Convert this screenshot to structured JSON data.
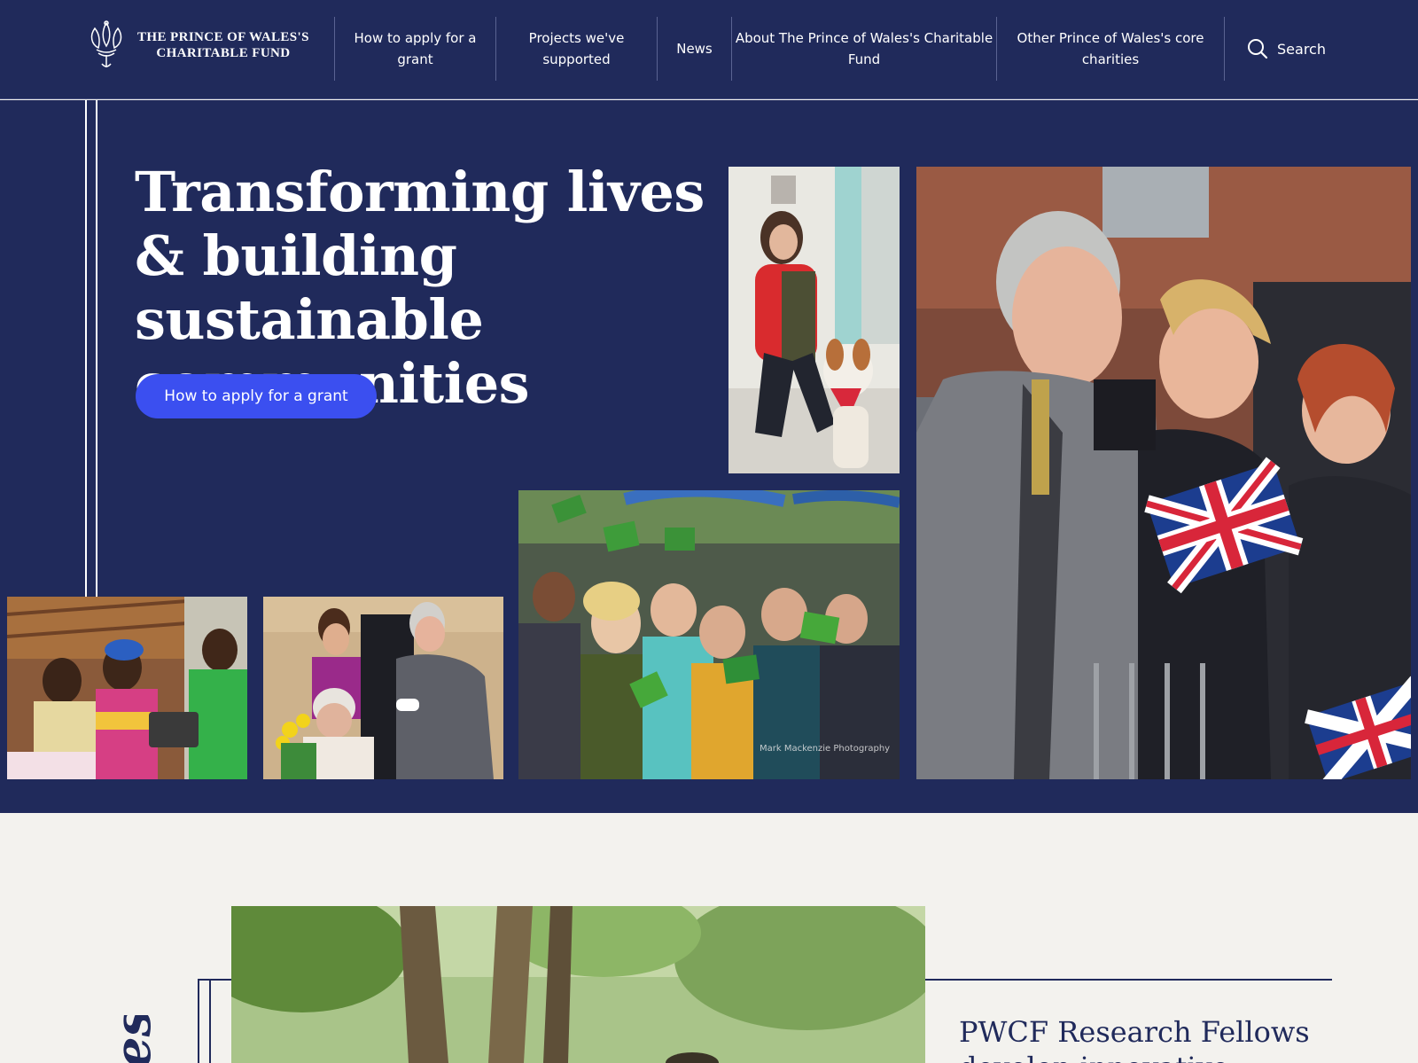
{
  "header": {
    "logo": {
      "line1": "THE PRINCE OF WALES'S",
      "line2": "CHARITABLE FUND"
    },
    "nav": [
      {
        "label": "How to apply for a grant"
      },
      {
        "label": "Projects we've supported"
      },
      {
        "label": "News"
      },
      {
        "label": "About The Prince of Wales's Charitable Fund"
      },
      {
        "label": "Other Prince of Wales's core charities"
      }
    ],
    "search_label": "Search"
  },
  "hero": {
    "headline": "Transforming lives & building sustainable communities",
    "cta_label": "How to apply for a grant",
    "photo_credit": "Mark Mackenzie Photography"
  },
  "lower": {
    "vertical_word": "es",
    "news_title": "PWCF Research Fellows develop innovative"
  },
  "colors": {
    "navy": "#202a5b",
    "cta_blue": "#3b4ff0",
    "page_bg": "#f3f2ee"
  }
}
